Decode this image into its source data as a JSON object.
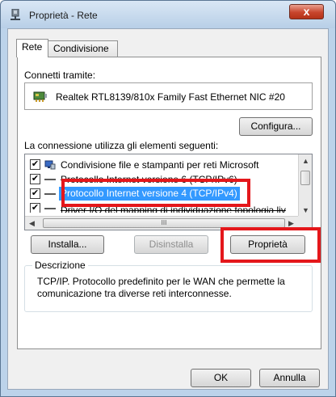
{
  "window": {
    "title": "Proprietà - Rete",
    "close_label": "x"
  },
  "tabs": [
    {
      "label": "Rete",
      "active": true
    },
    {
      "label": "Condivisione",
      "active": false
    }
  ],
  "connect_via": {
    "label": "Connetti tramite:",
    "adapter": "Realtek RTL8139/810x Family Fast Ethernet NIC #20",
    "adapter_icon": "network-adapter-icon"
  },
  "configure_button": "Configura...",
  "items_section": {
    "label": "La connessione utilizza gli elementi seguenti:",
    "items": [
      {
        "label": "Condivisione file e stampanti per reti Microsoft",
        "checked": true,
        "icon": "network-share-icon",
        "selected": false
      },
      {
        "label": "Protocollo Internet versione 6 (TCP/IPv6)",
        "checked": true,
        "icon": "protocol-icon",
        "selected": false
      },
      {
        "label": "Protocollo Internet versione 4 (TCP/IPv4)",
        "checked": true,
        "icon": "protocol-icon",
        "selected": true
      },
      {
        "label": "Driver I/O del mapping di individuazione topologia liv",
        "checked": true,
        "icon": "protocol-icon",
        "selected": false
      }
    ],
    "hscroll_grip": "III"
  },
  "buttons": {
    "install": "Installa...",
    "uninstall": "Disinstalla",
    "properties": "Proprietà",
    "ok": "OK",
    "cancel": "Annulla"
  },
  "description": {
    "legend": "Descrizione",
    "text": "TCP/IP. Protocollo predefinito per le WAN che permette la comunicazione tra diverse reti interconnesse."
  },
  "colors": {
    "selection": "#3399ff",
    "highlight_frame": "#e4171b"
  }
}
